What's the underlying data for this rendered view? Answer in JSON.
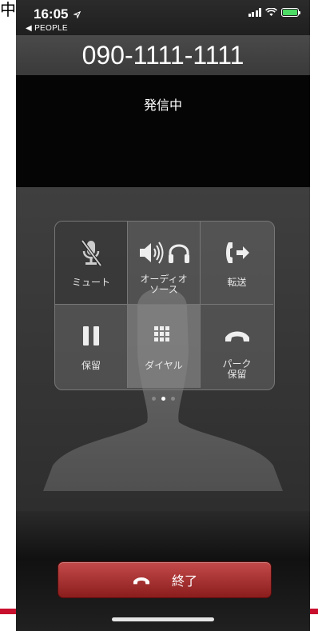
{
  "corner_text": "中",
  "status_bar": {
    "time": "16:05",
    "back_label": "◀ PEOPLE"
  },
  "call": {
    "number": "090-1111-1111",
    "status": "発信中"
  },
  "keypad": {
    "mute": {
      "label": "ミュート",
      "icon": "mic-slash-icon"
    },
    "audio": {
      "label": "オーディオ\nソース",
      "icon": "speaker-headphones-icon"
    },
    "transfer": {
      "label": "転送",
      "icon": "phone-forward-icon"
    },
    "hold": {
      "label": "保留",
      "icon": "pause-icon"
    },
    "dial": {
      "label": "ダイヤル",
      "icon": "keypad-icon"
    },
    "park": {
      "label": "パーク\n保留",
      "icon": "handset-icon"
    }
  },
  "end_call": {
    "label": "終了",
    "icon": "hangup-icon",
    "color": "#a52a2a"
  },
  "accent": "#c8102e"
}
